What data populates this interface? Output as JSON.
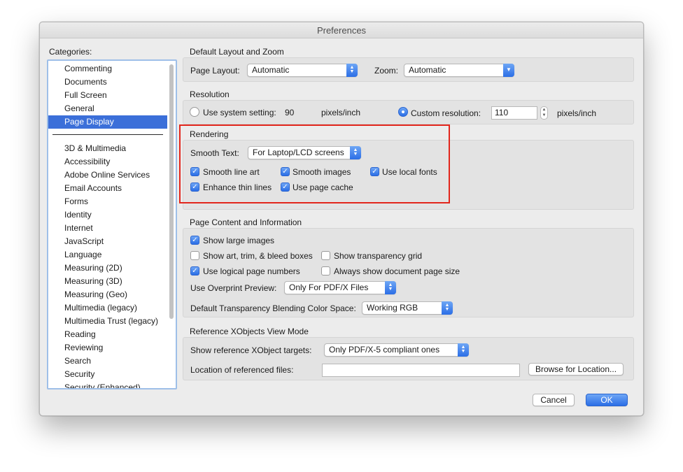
{
  "window": {
    "title": "Preferences"
  },
  "categories": {
    "label": "Categories:",
    "top_items": [
      "Commenting",
      "Documents",
      "Full Screen",
      "General",
      "Page Display"
    ],
    "selected": "Page Display",
    "items": [
      "3D & Multimedia",
      "Accessibility",
      "Adobe Online Services",
      "Email Accounts",
      "Forms",
      "Identity",
      "Internet",
      "JavaScript",
      "Language",
      "Measuring (2D)",
      "Measuring (3D)",
      "Measuring (Geo)",
      "Multimedia (legacy)",
      "Multimedia Trust (legacy)",
      "Reading",
      "Reviewing",
      "Search",
      "Security",
      "Security (Enhanced)"
    ]
  },
  "layout": {
    "title": "Default Layout and Zoom",
    "page_layout_label": "Page Layout:",
    "page_layout_value": "Automatic",
    "zoom_label": "Zoom:",
    "zoom_value": "Automatic"
  },
  "resolution": {
    "title": "Resolution",
    "system_label": "Use system setting:",
    "system_value": "90",
    "system_unit": "pixels/inch",
    "custom_label": "Custom resolution:",
    "custom_value": "110",
    "custom_unit": "pixels/inch",
    "custom_selected": true
  },
  "rendering": {
    "title": "Rendering",
    "smooth_text_label": "Smooth Text:",
    "smooth_text_value": "For Laptop/LCD screens",
    "smooth_line_art": "Smooth line art",
    "smooth_images": "Smooth images",
    "use_local_fonts": "Use local fonts",
    "enhance_thin_lines": "Enhance thin lines",
    "use_page_cache": "Use page cache"
  },
  "content": {
    "title": "Page Content and Information",
    "show_large_images": "Show large images",
    "show_art_trim": "Show art, trim, & bleed boxes",
    "show_transparency_grid": "Show transparency grid",
    "use_logical_page_numbers": "Use logical page numbers",
    "always_show_doc_page_size": "Always show document page size",
    "overprint_label": "Use Overprint Preview:",
    "overprint_value": "Only For PDF/X Files",
    "blending_label": "Default Transparency Blending Color Space:",
    "blending_value": "Working RGB"
  },
  "xobjects": {
    "title": "Reference XObjects View Mode",
    "targets_label": "Show reference XObject targets:",
    "targets_value": "Only PDF/X-5 compliant ones",
    "location_label": "Location of referenced files:",
    "location_value": "",
    "browse_label": "Browse for Location..."
  },
  "footer": {
    "cancel": "Cancel",
    "ok": "OK"
  },
  "colors": {
    "accent": "#3b6fd9",
    "highlight": "#e2261c"
  }
}
